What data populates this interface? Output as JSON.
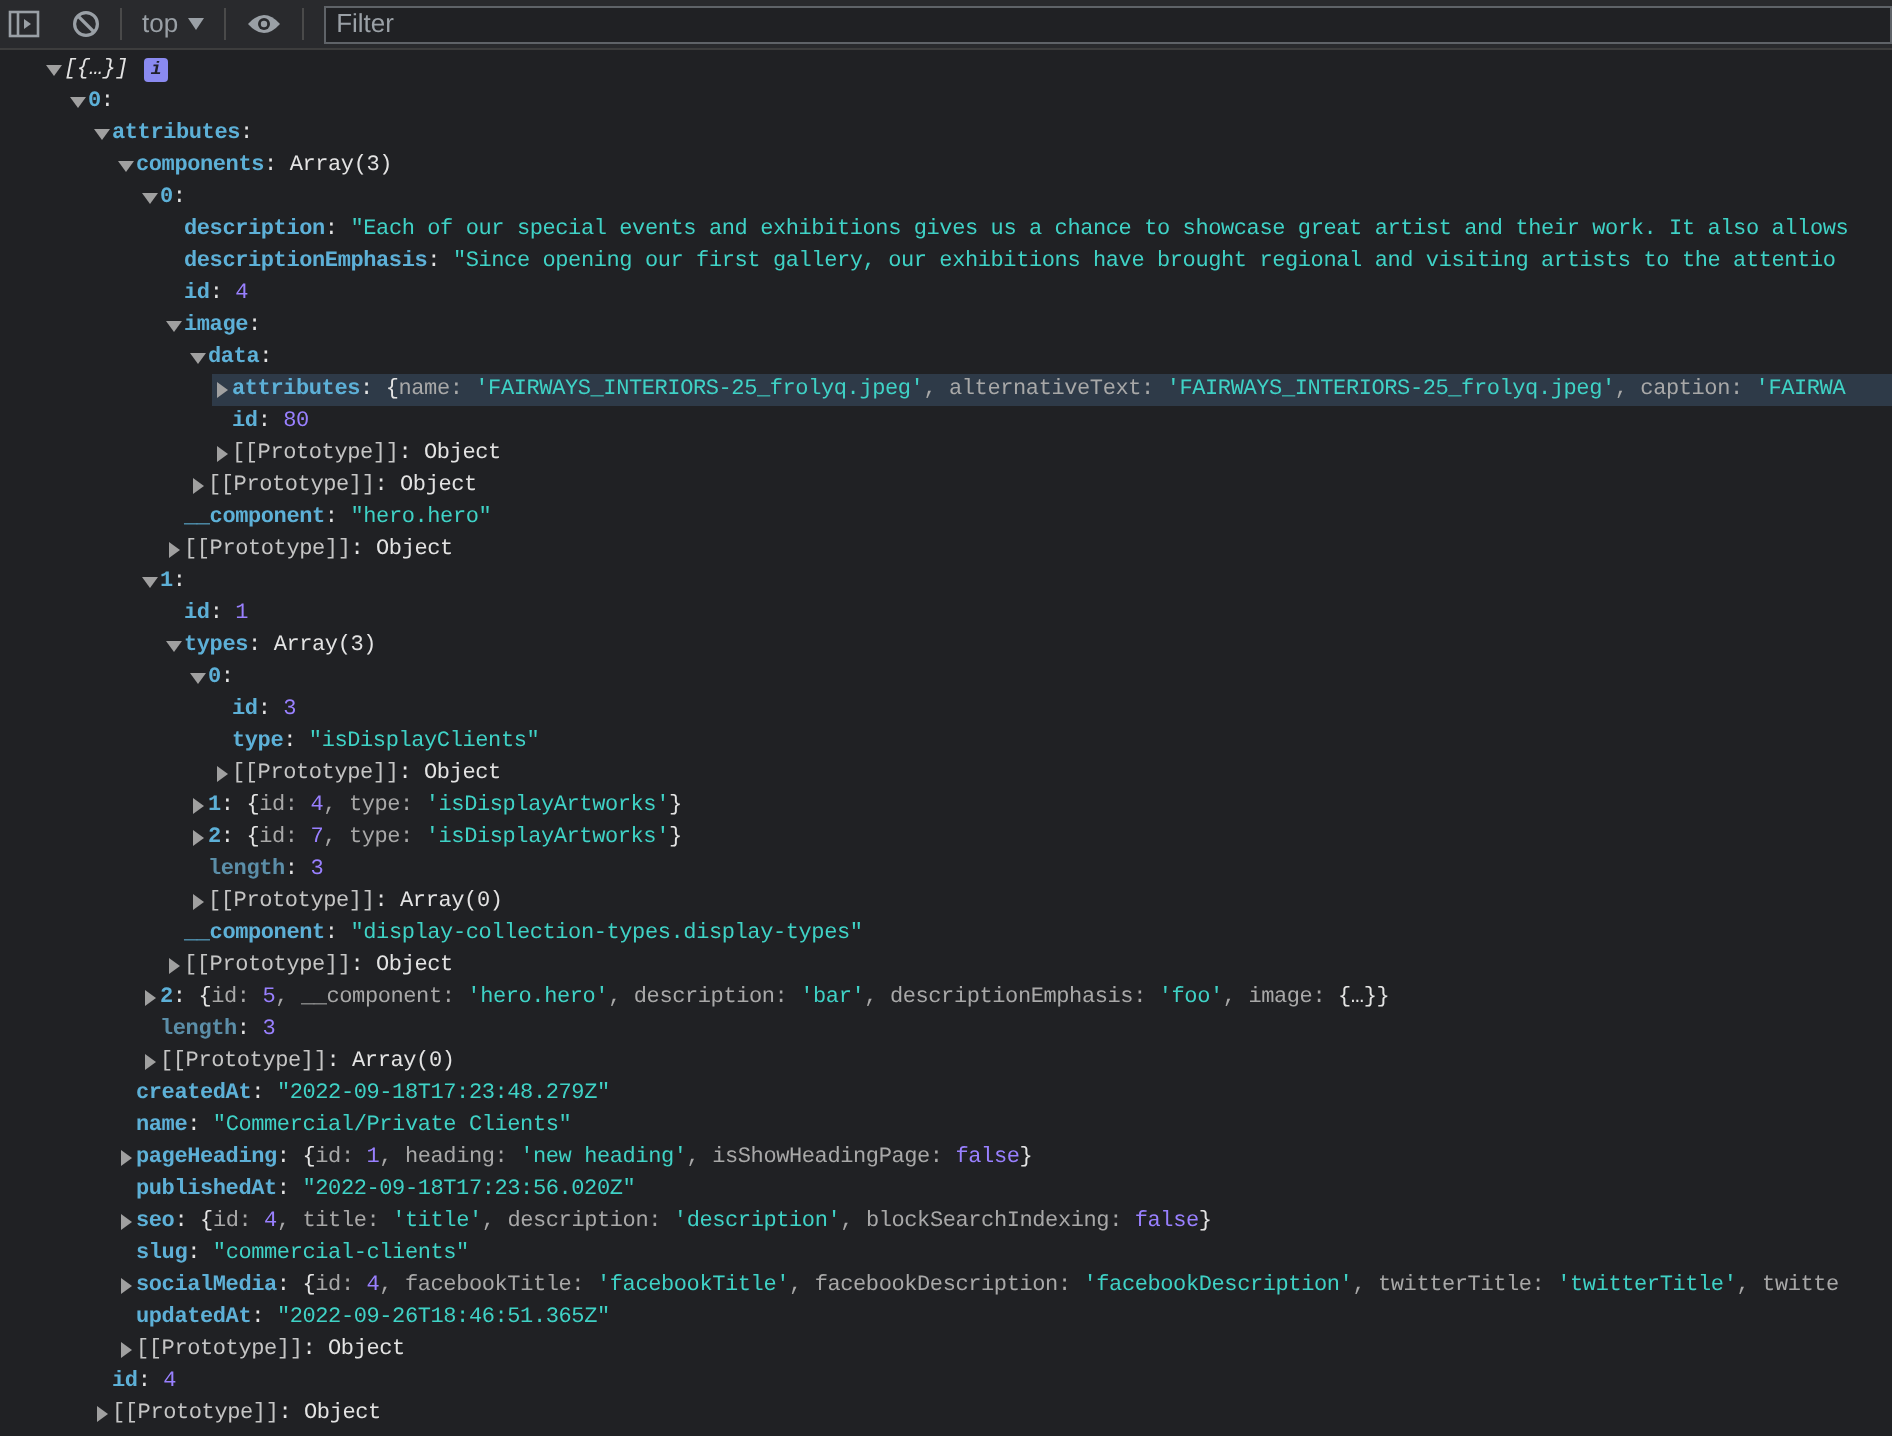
{
  "toolbar": {
    "context": "top",
    "filter": {
      "placeholder": "Filter"
    }
  },
  "tree": [
    {
      "expanded": true,
      "badge": "i",
      "parts": [
        {
          "kind": "preview",
          "text": "[{…}]"
        }
      ],
      "children": [
        {
          "expanded": true,
          "parts": [
            {
              "kind": "key",
              "text": "0"
            },
            {
              "kind": "punct",
              "text": ":"
            }
          ],
          "children": [
            {
              "expanded": true,
              "parts": [
                {
                  "kind": "key",
                  "text": "attributes"
                },
                {
                  "kind": "punct",
                  "text": ":"
                }
              ],
              "children": [
                {
                  "expanded": true,
                  "parts": [
                    {
                      "kind": "key",
                      "text": "components"
                    },
                    {
                      "kind": "punct",
                      "text": ": "
                    },
                    {
                      "kind": "object",
                      "text": "Array(3)"
                    }
                  ],
                  "children": [
                    {
                      "expanded": true,
                      "parts": [
                        {
                          "kind": "key",
                          "text": "0"
                        },
                        {
                          "kind": "punct",
                          "text": ":"
                        }
                      ],
                      "children": [
                        {
                          "parts": [
                            {
                              "kind": "key",
                              "text": "description"
                            },
                            {
                              "kind": "punct",
                              "text": ": "
                            },
                            {
                              "kind": "string",
                              "text": "\"Each of our special events and exhibitions gives us a chance to showcase great artist and their work. It also allows"
                            }
                          ]
                        },
                        {
                          "parts": [
                            {
                              "kind": "key",
                              "text": "descriptionEmphasis"
                            },
                            {
                              "kind": "punct",
                              "text": ": "
                            },
                            {
                              "kind": "string",
                              "text": "\"Since opening our first gallery, our exhibitions have brought regional and visiting artists to the attentio"
                            }
                          ]
                        },
                        {
                          "parts": [
                            {
                              "kind": "key",
                              "text": "id"
                            },
                            {
                              "kind": "punct",
                              "text": ": "
                            },
                            {
                              "kind": "number",
                              "text": "4"
                            }
                          ]
                        },
                        {
                          "expanded": true,
                          "parts": [
                            {
                              "kind": "key",
                              "text": "image"
                            },
                            {
                              "kind": "punct",
                              "text": ":"
                            }
                          ],
                          "children": [
                            {
                              "expanded": true,
                              "parts": [
                                {
                                  "kind": "key",
                                  "text": "data"
                                },
                                {
                                  "kind": "punct",
                                  "text": ":"
                                }
                              ],
                              "children": [
                                {
                                  "expanded": false,
                                  "highlighted": true,
                                  "parts": [
                                    {
                                      "kind": "key",
                                      "text": "attributes"
                                    },
                                    {
                                      "kind": "punct",
                                      "text": ": {"
                                    },
                                    {
                                      "kind": "prop",
                                      "text": "name: "
                                    },
                                    {
                                      "kind": "string",
                                      "text": "'FAIRWAYS_INTERIORS-25_frolyq.jpeg'"
                                    },
                                    {
                                      "kind": "prop",
                                      "text": ", alternativeText: "
                                    },
                                    {
                                      "kind": "string",
                                      "text": "'FAIRWAYS_INTERIORS-25_frolyq.jpeg'"
                                    },
                                    {
                                      "kind": "prop",
                                      "text": ", caption: "
                                    },
                                    {
                                      "kind": "string",
                                      "text": "'FAIRWA"
                                    }
                                  ]
                                },
                                {
                                  "parts": [
                                    {
                                      "kind": "key",
                                      "text": "id"
                                    },
                                    {
                                      "kind": "punct",
                                      "text": ": "
                                    },
                                    {
                                      "kind": "number",
                                      "text": "80"
                                    }
                                  ]
                                },
                                {
                                  "expanded": false,
                                  "parts": [
                                    {
                                      "kind": "internal",
                                      "text": "[[Prototype]]"
                                    },
                                    {
                                      "kind": "punct",
                                      "text": ": "
                                    },
                                    {
                                      "kind": "object",
                                      "text": "Object"
                                    }
                                  ]
                                }
                              ]
                            },
                            {
                              "expanded": false,
                              "parts": [
                                {
                                  "kind": "internal",
                                  "text": "[[Prototype]]"
                                },
                                {
                                  "kind": "punct",
                                  "text": ": "
                                },
                                {
                                  "kind": "object",
                                  "text": "Object"
                                }
                              ]
                            }
                          ]
                        },
                        {
                          "parts": [
                            {
                              "kind": "key",
                              "text": "__component"
                            },
                            {
                              "kind": "punct",
                              "text": ": "
                            },
                            {
                              "kind": "string",
                              "text": "\"hero.hero\""
                            }
                          ]
                        },
                        {
                          "expanded": false,
                          "parts": [
                            {
                              "kind": "internal",
                              "text": "[[Prototype]]"
                            },
                            {
                              "kind": "punct",
                              "text": ": "
                            },
                            {
                              "kind": "object",
                              "text": "Object"
                            }
                          ]
                        }
                      ]
                    },
                    {
                      "expanded": true,
                      "parts": [
                        {
                          "kind": "key",
                          "text": "1"
                        },
                        {
                          "kind": "punct",
                          "text": ":"
                        }
                      ],
                      "children": [
                        {
                          "parts": [
                            {
                              "kind": "key",
                              "text": "id"
                            },
                            {
                              "kind": "punct",
                              "text": ": "
                            },
                            {
                              "kind": "number",
                              "text": "1"
                            }
                          ]
                        },
                        {
                          "expanded": true,
                          "parts": [
                            {
                              "kind": "key",
                              "text": "types"
                            },
                            {
                              "kind": "punct",
                              "text": ": "
                            },
                            {
                              "kind": "object",
                              "text": "Array(3)"
                            }
                          ],
                          "children": [
                            {
                              "expanded": true,
                              "parts": [
                                {
                                  "kind": "key",
                                  "text": "0"
                                },
                                {
                                  "kind": "punct",
                                  "text": ":"
                                }
                              ],
                              "children": [
                                {
                                  "parts": [
                                    {
                                      "kind": "key",
                                      "text": "id"
                                    },
                                    {
                                      "kind": "punct",
                                      "text": ": "
                                    },
                                    {
                                      "kind": "number",
                                      "text": "3"
                                    }
                                  ]
                                },
                                {
                                  "parts": [
                                    {
                                      "kind": "key",
                                      "text": "type"
                                    },
                                    {
                                      "kind": "punct",
                                      "text": ": "
                                    },
                                    {
                                      "kind": "string",
                                      "text": "\"isDisplayClients\""
                                    }
                                  ]
                                },
                                {
                                  "expanded": false,
                                  "parts": [
                                    {
                                      "kind": "internal",
                                      "text": "[[Prototype]]"
                                    },
                                    {
                                      "kind": "punct",
                                      "text": ": "
                                    },
                                    {
                                      "kind": "object",
                                      "text": "Object"
                                    }
                                  ]
                                }
                              ]
                            },
                            {
                              "expanded": false,
                              "parts": [
                                {
                                  "kind": "key",
                                  "text": "1"
                                },
                                {
                                  "kind": "punct",
                                  "text": ": {"
                                },
                                {
                                  "kind": "prop",
                                  "text": "id: "
                                },
                                {
                                  "kind": "number",
                                  "text": "4"
                                },
                                {
                                  "kind": "prop",
                                  "text": ", type: "
                                },
                                {
                                  "kind": "string",
                                  "text": "'isDisplayArtworks'"
                                },
                                {
                                  "kind": "punct",
                                  "text": "}"
                                }
                              ]
                            },
                            {
                              "expanded": false,
                              "parts": [
                                {
                                  "kind": "key",
                                  "text": "2"
                                },
                                {
                                  "kind": "punct",
                                  "text": ": {"
                                },
                                {
                                  "kind": "prop",
                                  "text": "id: "
                                },
                                {
                                  "kind": "number",
                                  "text": "7"
                                },
                                {
                                  "kind": "prop",
                                  "text": ", type: "
                                },
                                {
                                  "kind": "string",
                                  "text": "'isDisplayArtworks'"
                                },
                                {
                                  "kind": "punct",
                                  "text": "}"
                                }
                              ]
                            },
                            {
                              "parts": [
                                {
                                  "kind": "dimkey",
                                  "text": "length"
                                },
                                {
                                  "kind": "punct",
                                  "text": ": "
                                },
                                {
                                  "kind": "number",
                                  "text": "3"
                                }
                              ]
                            },
                            {
                              "expanded": false,
                              "parts": [
                                {
                                  "kind": "internal",
                                  "text": "[[Prototype]]"
                                },
                                {
                                  "kind": "punct",
                                  "text": ": "
                                },
                                {
                                  "kind": "object",
                                  "text": "Array(0)"
                                }
                              ]
                            }
                          ]
                        },
                        {
                          "parts": [
                            {
                              "kind": "key",
                              "text": "__component"
                            },
                            {
                              "kind": "punct",
                              "text": ": "
                            },
                            {
                              "kind": "string",
                              "text": "\"display-collection-types.display-types\""
                            }
                          ]
                        },
                        {
                          "expanded": false,
                          "parts": [
                            {
                              "kind": "internal",
                              "text": "[[Prototype]]"
                            },
                            {
                              "kind": "punct",
                              "text": ": "
                            },
                            {
                              "kind": "object",
                              "text": "Object"
                            }
                          ]
                        }
                      ]
                    },
                    {
                      "expanded": false,
                      "parts": [
                        {
                          "kind": "key",
                          "text": "2"
                        },
                        {
                          "kind": "punct",
                          "text": ": {"
                        },
                        {
                          "kind": "prop",
                          "text": "id: "
                        },
                        {
                          "kind": "number",
                          "text": "5"
                        },
                        {
                          "kind": "prop",
                          "text": ", __component: "
                        },
                        {
                          "kind": "string",
                          "text": "'hero.hero'"
                        },
                        {
                          "kind": "prop",
                          "text": ", description: "
                        },
                        {
                          "kind": "string",
                          "text": "'bar'"
                        },
                        {
                          "kind": "prop",
                          "text": ", descriptionEmphasis: "
                        },
                        {
                          "kind": "string",
                          "text": "'foo'"
                        },
                        {
                          "kind": "prop",
                          "text": ", image: "
                        },
                        {
                          "kind": "punct",
                          "text": "{…}}"
                        }
                      ]
                    },
                    {
                      "parts": [
                        {
                          "kind": "dimkey",
                          "text": "length"
                        },
                        {
                          "kind": "punct",
                          "text": ": "
                        },
                        {
                          "kind": "number",
                          "text": "3"
                        }
                      ]
                    },
                    {
                      "expanded": false,
                      "parts": [
                        {
                          "kind": "internal",
                          "text": "[[Prototype]]"
                        },
                        {
                          "kind": "punct",
                          "text": ": "
                        },
                        {
                          "kind": "object",
                          "text": "Array(0)"
                        }
                      ]
                    }
                  ]
                },
                {
                  "parts": [
                    {
                      "kind": "key",
                      "text": "createdAt"
                    },
                    {
                      "kind": "punct",
                      "text": ": "
                    },
                    {
                      "kind": "string",
                      "text": "\"2022-09-18T17:23:48.279Z\""
                    }
                  ]
                },
                {
                  "parts": [
                    {
                      "kind": "key",
                      "text": "name"
                    },
                    {
                      "kind": "punct",
                      "text": ": "
                    },
                    {
                      "kind": "string",
                      "text": "\"Commercial/Private Clients\""
                    }
                  ]
                },
                {
                  "expanded": false,
                  "parts": [
                    {
                      "kind": "key",
                      "text": "pageHeading"
                    },
                    {
                      "kind": "punct",
                      "text": ": {"
                    },
                    {
                      "kind": "prop",
                      "text": "id: "
                    },
                    {
                      "kind": "number",
                      "text": "1"
                    },
                    {
                      "kind": "prop",
                      "text": ", heading: "
                    },
                    {
                      "kind": "string",
                      "text": "'new heading'"
                    },
                    {
                      "kind": "prop",
                      "text": ", isShowHeadingPage: "
                    },
                    {
                      "kind": "number",
                      "text": "false"
                    },
                    {
                      "kind": "punct",
                      "text": "}"
                    }
                  ]
                },
                {
                  "parts": [
                    {
                      "kind": "key",
                      "text": "publishedAt"
                    },
                    {
                      "kind": "punct",
                      "text": ": "
                    },
                    {
                      "kind": "string",
                      "text": "\"2022-09-18T17:23:56.020Z\""
                    }
                  ]
                },
                {
                  "expanded": false,
                  "parts": [
                    {
                      "kind": "key",
                      "text": "seo"
                    },
                    {
                      "kind": "punct",
                      "text": ": {"
                    },
                    {
                      "kind": "prop",
                      "text": "id: "
                    },
                    {
                      "kind": "number",
                      "text": "4"
                    },
                    {
                      "kind": "prop",
                      "text": ", title: "
                    },
                    {
                      "kind": "string",
                      "text": "'title'"
                    },
                    {
                      "kind": "prop",
                      "text": ", description: "
                    },
                    {
                      "kind": "string",
                      "text": "'description'"
                    },
                    {
                      "kind": "prop",
                      "text": ", blockSearchIndexing: "
                    },
                    {
                      "kind": "number",
                      "text": "false"
                    },
                    {
                      "kind": "punct",
                      "text": "}"
                    }
                  ]
                },
                {
                  "parts": [
                    {
                      "kind": "key",
                      "text": "slug"
                    },
                    {
                      "kind": "punct",
                      "text": ": "
                    },
                    {
                      "kind": "string",
                      "text": "\"commercial-clients\""
                    }
                  ]
                },
                {
                  "expanded": false,
                  "parts": [
                    {
                      "kind": "key",
                      "text": "socialMedia"
                    },
                    {
                      "kind": "punct",
                      "text": ": {"
                    },
                    {
                      "kind": "prop",
                      "text": "id: "
                    },
                    {
                      "kind": "number",
                      "text": "4"
                    },
                    {
                      "kind": "prop",
                      "text": ", facebookTitle: "
                    },
                    {
                      "kind": "string",
                      "text": "'facebookTitle'"
                    },
                    {
                      "kind": "prop",
                      "text": ", facebookDescription: "
                    },
                    {
                      "kind": "string",
                      "text": "'facebookDescription'"
                    },
                    {
                      "kind": "prop",
                      "text": ", twitterTitle: "
                    },
                    {
                      "kind": "string",
                      "text": "'twitterTitle'"
                    },
                    {
                      "kind": "prop",
                      "text": ", twitte"
                    }
                  ]
                },
                {
                  "parts": [
                    {
                      "kind": "key",
                      "text": "updatedAt"
                    },
                    {
                      "kind": "punct",
                      "text": ": "
                    },
                    {
                      "kind": "string",
                      "text": "\"2022-09-26T18:46:51.365Z\""
                    }
                  ]
                },
                {
                  "expanded": false,
                  "parts": [
                    {
                      "kind": "internal",
                      "text": "[[Prototype]]"
                    },
                    {
                      "kind": "punct",
                      "text": ": "
                    },
                    {
                      "kind": "object",
                      "text": "Object"
                    }
                  ]
                }
              ]
            },
            {
              "parts": [
                {
                  "kind": "key",
                  "text": "id"
                },
                {
                  "kind": "punct",
                  "text": ": "
                },
                {
                  "kind": "number",
                  "text": "4"
                }
              ]
            },
            {
              "expanded": false,
              "parts": [
                {
                  "kind": "internal",
                  "text": "[[Prototype]]"
                },
                {
                  "kind": "punct",
                  "text": ": "
                },
                {
                  "kind": "object",
                  "text": "Object"
                }
              ]
            }
          ]
        }
      ]
    }
  ]
}
